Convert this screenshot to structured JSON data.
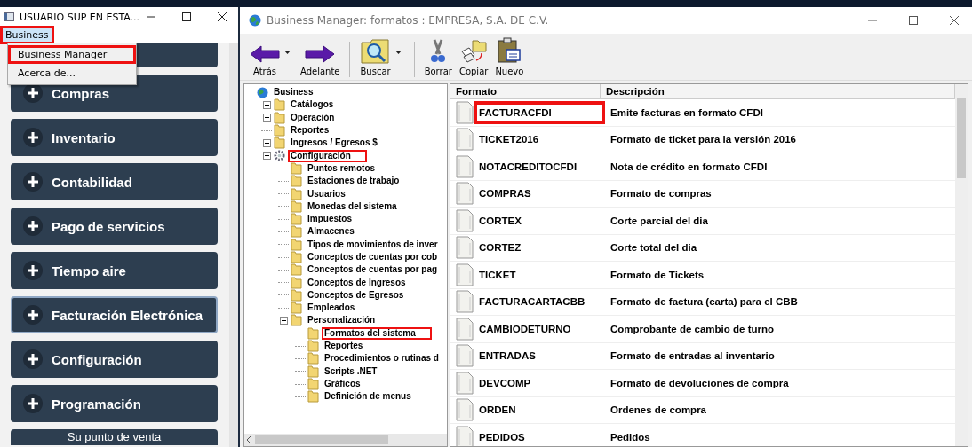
{
  "left_window": {
    "title": "USUARIO SUP EN ESTA...",
    "menu_bar": [
      {
        "label": "Business",
        "selected": true
      }
    ],
    "dropdown": [
      {
        "label": "Business Manager",
        "highlighted": true
      },
      {
        "label": "Acerca de...",
        "highlighted": false
      }
    ],
    "sidebar": {
      "items": [
        {
          "kind": "covered"
        },
        {
          "kind": "menu",
          "label": "Compras",
          "selected": false
        },
        {
          "kind": "menu",
          "label": "Inventario",
          "selected": false
        },
        {
          "kind": "menu",
          "label": "Contabilidad",
          "selected": false
        },
        {
          "kind": "menu",
          "label": "Pago de servicios",
          "selected": false
        },
        {
          "kind": "menu",
          "label": "Tiempo aire",
          "selected": false
        },
        {
          "kind": "menu",
          "label": "Facturación Electrónica",
          "selected": true
        },
        {
          "kind": "menu",
          "label": "Configuración",
          "selected": false
        },
        {
          "kind": "menu",
          "label": "Programación",
          "selected": false
        },
        {
          "kind": "footer",
          "label": "Su punto de venta"
        }
      ]
    }
  },
  "main_window": {
    "title": "Business Manager: formatos : EMPRESA, S.A. DE C.V.",
    "toolbar": [
      {
        "kind": "back",
        "label": "Atrás",
        "dropdown": true
      },
      {
        "kind": "forward",
        "label": "Adelante",
        "dropdown": false
      },
      {
        "kind": "search",
        "label": "Buscar",
        "dropdown": true
      },
      {
        "kind": "delete",
        "label": "Borrar",
        "dropdown": false
      },
      {
        "kind": "copy",
        "label": "Copiar",
        "dropdown": false
      },
      {
        "kind": "new",
        "label": "Nuevo",
        "dropdown": false
      }
    ],
    "tree": [
      {
        "label": "Business",
        "kind": "root",
        "highlighted": false,
        "children": [
          {
            "label": "Catálogos",
            "expanded": false,
            "highlighted": false
          },
          {
            "label": "Operación",
            "expanded": false,
            "highlighted": false
          },
          {
            "label": "Reportes",
            "highlighted": false
          },
          {
            "label": "Ingresos / Egresos $",
            "expanded": false,
            "highlighted": false
          },
          {
            "label": "Configuración",
            "kind": "settings",
            "expanded": true,
            "highlighted": true,
            "children": [
              {
                "label": "Puntos remotos",
                "highlighted": false
              },
              {
                "label": "Estaciones de trabajo",
                "highlighted": false
              },
              {
                "label": "Usuarios",
                "highlighted": false
              },
              {
                "label": "Monedas del sistema",
                "highlighted": false
              },
              {
                "label": "Impuestos",
                "highlighted": false
              },
              {
                "label": "Almacenes",
                "highlighted": false
              },
              {
                "label": "Tipos de movimientos de inver",
                "highlighted": false
              },
              {
                "label": "Conceptos de cuentas por cob",
                "highlighted": false
              },
              {
                "label": "Conceptos de cuentas por pag",
                "highlighted": false
              },
              {
                "label": "Conceptos de Ingresos",
                "highlighted": false
              },
              {
                "label": "Conceptos de Egresos",
                "highlighted": false
              },
              {
                "label": "Empleados",
                "highlighted": false
              },
              {
                "label": "Personalización",
                "expanded": true,
                "highlighted": false,
                "children": [
                  {
                    "label": "Formatos del sistema",
                    "highlighted": true
                  },
                  {
                    "label": "Reportes",
                    "highlighted": false
                  },
                  {
                    "label": "Procedimientos o rutinas d",
                    "highlighted": false
                  },
                  {
                    "label": "Scripts .NET",
                    "highlighted": false
                  },
                  {
                    "label": "Gráficos",
                    "highlighted": false
                  },
                  {
                    "label": "Definición de menus",
                    "highlighted": false
                  }
                ]
              }
            ]
          }
        ]
      }
    ],
    "table": {
      "columns": [
        "Formato",
        "Descripción"
      ],
      "rows": [
        {
          "cells": [
            "FACTURACFDI",
            "Emite facturas en formato CFDI"
          ],
          "highlighted": true
        },
        {
          "cells": [
            "TICKET2016",
            "Formato de ticket para la versión 2016"
          ],
          "highlighted": false
        },
        {
          "cells": [
            "NOTACREDITOCFDI",
            "Nota de crédito en formato CFDI"
          ],
          "highlighted": false
        },
        {
          "cells": [
            "COMPRAS",
            "Formato de compras"
          ],
          "highlighted": false
        },
        {
          "cells": [
            "CORTEX",
            "Corte parcial del dia"
          ],
          "highlighted": false
        },
        {
          "cells": [
            "CORTEZ",
            "Corte total del dia"
          ],
          "highlighted": false
        },
        {
          "cells": [
            "TICKET",
            "Formato de Tickets"
          ],
          "highlighted": false
        },
        {
          "cells": [
            "FACTURACARTACBB",
            "Formato de factura (carta) para el CBB"
          ],
          "highlighted": false
        },
        {
          "cells": [
            "CAMBIODETURNO",
            "Comprobante de cambio de turno"
          ],
          "highlighted": false
        },
        {
          "cells": [
            "ENTRADAS",
            "Formato de entradas al inventario"
          ],
          "highlighted": false
        },
        {
          "cells": [
            "DEVCOMP",
            "Formato de devoluciones de compra"
          ],
          "highlighted": false
        },
        {
          "cells": [
            "ORDEN",
            "Ordenes de compra"
          ],
          "highlighted": false
        },
        {
          "cells": [
            "PEDIDOS",
            "Pedidos"
          ],
          "highlighted": false
        }
      ]
    }
  }
}
